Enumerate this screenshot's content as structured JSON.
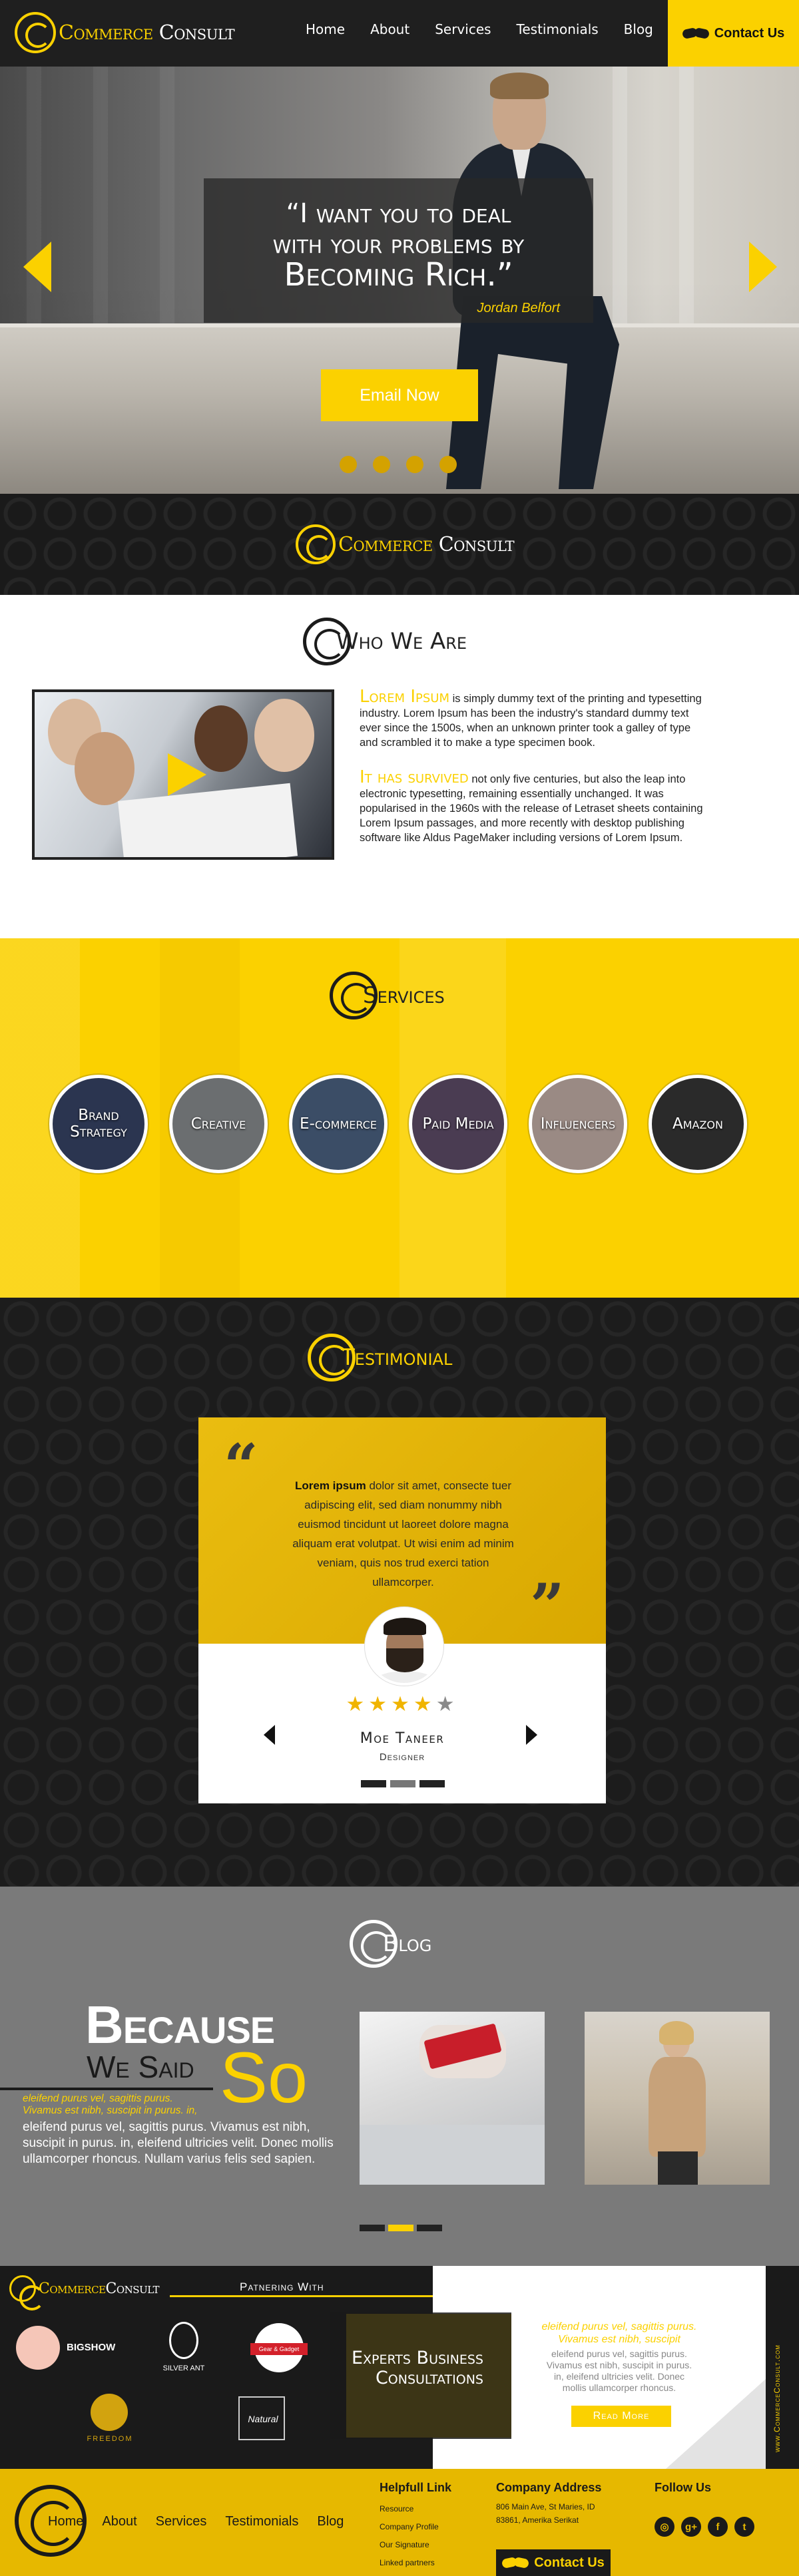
{
  "brand": {
    "name_first": "Commerce",
    "name_second": "Consult"
  },
  "nav": {
    "items": [
      "Home",
      "About",
      "Services",
      "Testimonials",
      "Blog"
    ],
    "contact": "Contact Us"
  },
  "hero": {
    "quote_line1": "“I want you to deal",
    "quote_line2": "with your problems by",
    "quote_line3": "Becoming Rich.”",
    "author": "Jordan Belfort",
    "cta": "Email Now",
    "slide_count": 4
  },
  "who": {
    "title": "Who We Are",
    "p1_highlight": "Lorem Ipsum",
    "p1_text": " is simply dummy text of the printing and typesetting industry. Lorem Ipsum has been the industry's standard dummy text ever since the 1500s, when an unknown printer took a galley of type and scrambled it to make a type specimen book.",
    "p2_highlight": "It has survived",
    "p2_text": " not only five centuries, but also the leap into electronic typesetting, remaining essentially unchanged. It was popularised in the 1960s with the release of Letraset sheets containing Lorem Ipsum passages, and more recently with desktop publishing software like Aldus PageMaker including versions of Lorem Ipsum."
  },
  "services": {
    "title": "Services",
    "items": [
      "Brand Strategy",
      "Creative",
      "E-commerce",
      "Paid Media",
      "Influencers",
      "Amazon"
    ]
  },
  "testimonial": {
    "title": "Testimonial",
    "lead": "Lorem ipsum",
    "text": " dolor sit amet, consecte tuer adipiscing elit, sed diam nonummy nibh euismod tincidunt ut laoreet dolore magna aliquam erat volutpat. Ut wisi enim ad minim veniam, quis nos trud exerci tation ullamcorper.",
    "name": "Moe Taneer",
    "role": "Designer",
    "rating": 4,
    "rating_max": 5
  },
  "blog": {
    "title": "Blog",
    "because": "Because",
    "we_said": "We Said",
    "so": "So",
    "yellow_line1": "eleifend  purus vel, sagittis purus.",
    "yellow_line2": "Vivamus est nibh, suscipit in purus. in,",
    "body": "eleifend  purus vel, sagittis purus. Vivamus est nibh, suscipit in purus. in, eleifend ultricies velit. Donec mollis ullamcorper rhoncus. Nullam varius felis sed sapien."
  },
  "partner": {
    "title": "Patnering With",
    "logos": [
      "BIGSHOW",
      "SILVER ANT",
      "Gear & Gadget",
      "FREEDOM",
      "Natural"
    ],
    "experts": "Experts Business Consultations",
    "right_yellow": "eleifend  purus vel, sagittis purus. Vivamus est nibh, suscipit",
    "right_gray": "eleifend  purus vel, sagittis purus. Vivamus est nibh, suscipit in purus. in, eleifend ultricies velit.  Donec mollis ullamcorper rhoncus.",
    "read_more": "Read More",
    "site": "www.CommerceConsult.com"
  },
  "footer": {
    "nav": [
      "Home",
      "About",
      "Services",
      "Testimonials",
      "Blog"
    ],
    "helpful_title": "Helpfull Link",
    "helpful_links": [
      "Resource",
      "Company Profile",
      "Our Signature",
      "Linked partners"
    ],
    "address_title": "Company Address",
    "address": "806 Main Ave, St Maries, ID 83861, Amerika Serikat",
    "follow_title": "Follow Us",
    "social": [
      "instagram-icon",
      "google-plus-icon",
      "facebook-icon",
      "twitter-icon"
    ],
    "contact": "Contact Us"
  },
  "colors": {
    "accent": "#fbd100",
    "dark": "#1e1e1e",
    "gray": "#7a7a7a"
  }
}
